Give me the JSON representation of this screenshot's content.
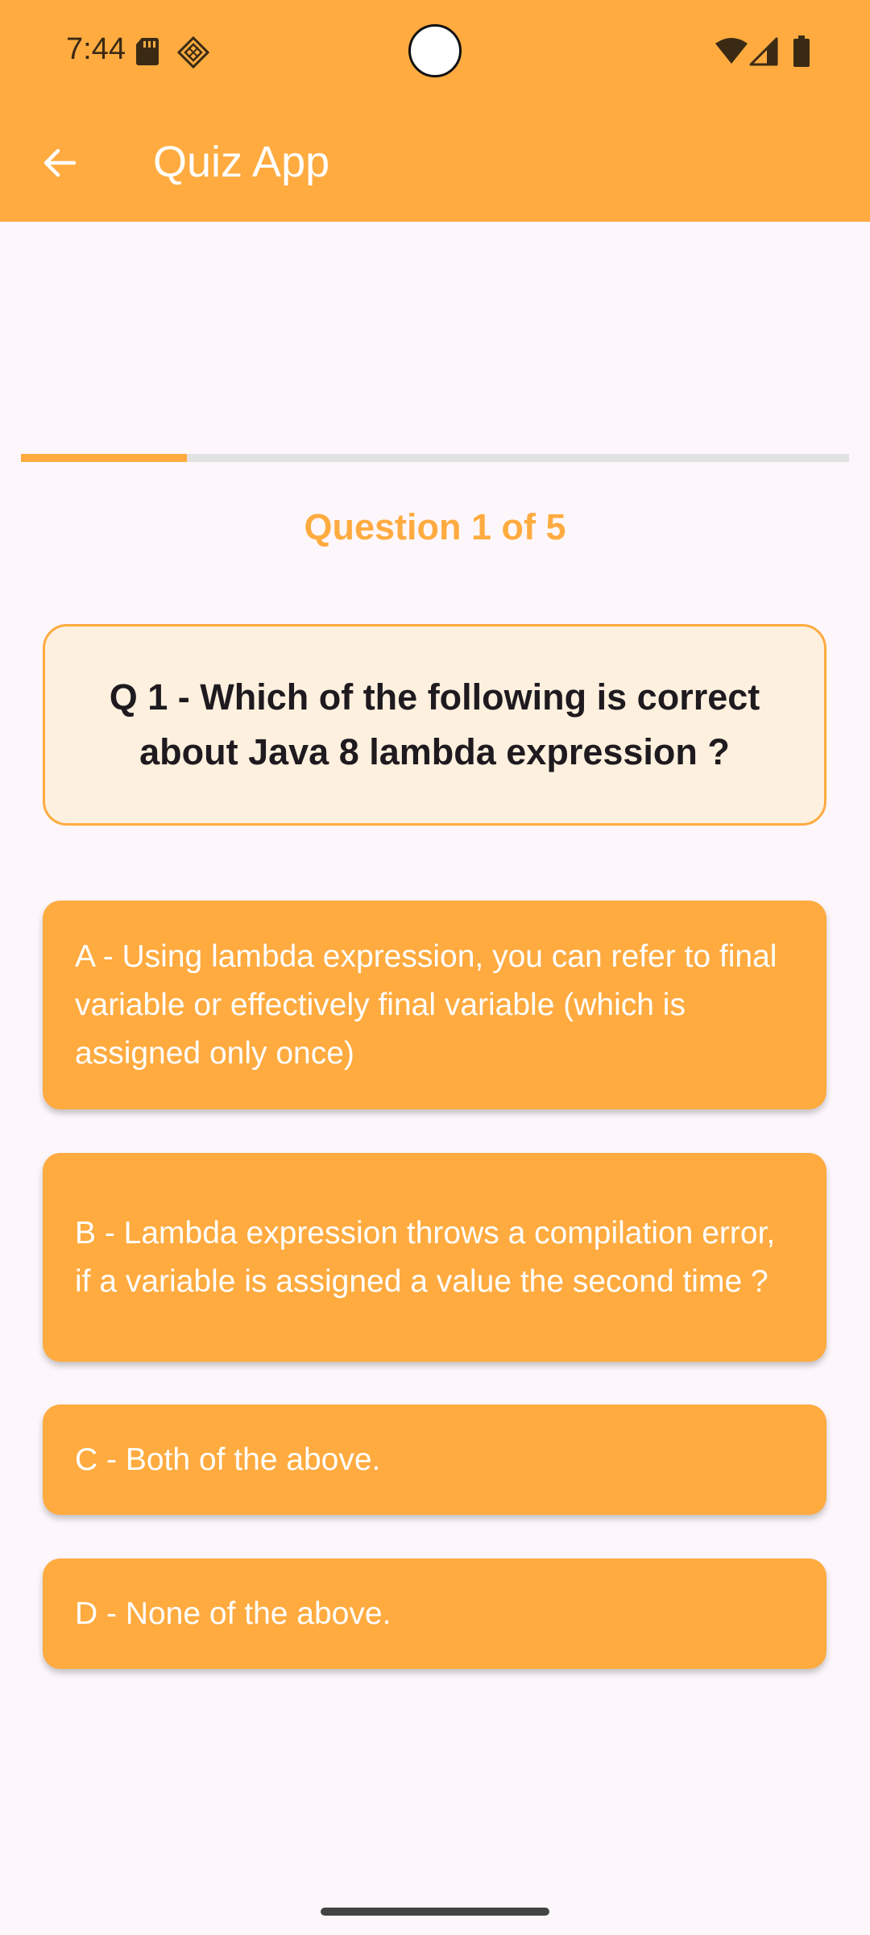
{
  "status_bar": {
    "time": "7:44",
    "icons": [
      "sd-card-icon",
      "diamond-icon",
      "wifi-icon",
      "signal-icon",
      "battery-icon"
    ]
  },
  "toolbar": {
    "back_icon": "arrow-back-icon",
    "title": "Quiz App"
  },
  "progress": {
    "fraction": 0.2
  },
  "quiz": {
    "counter": "Question 1 of 5",
    "question": "Q 1 - Which of the following is correct about Java 8 lambda expression ?",
    "options": [
      {
        "label": "A - Using lambda expression, you can refer to final variable or effectively final variable (which is assigned only once)"
      },
      {
        "label": "B - Lambda expression throws a compilation error, if a variable is assigned a value the second time ?"
      },
      {
        "label": "C - Both of the above."
      },
      {
        "label": "D - None of the above."
      }
    ]
  },
  "colors": {
    "accent": "#ffab40",
    "background": "#fdf7fb",
    "question_card_bg": "#fdf0de",
    "question_text": "#1e1a1f",
    "progress_track": "#e2e2e2"
  }
}
